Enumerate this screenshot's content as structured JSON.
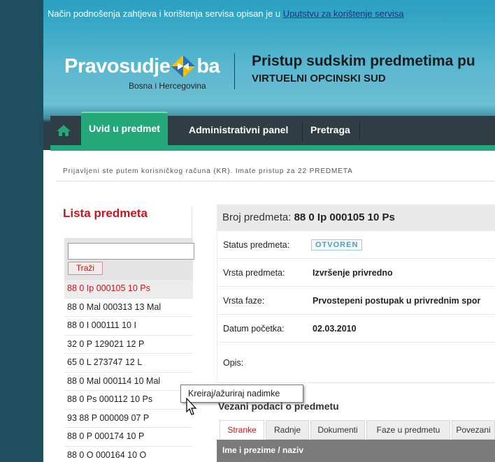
{
  "info_bar": {
    "text": "Način podnošenja zahtjeva i korištenja servisa opisan je u",
    "link": "Uputstvu za korištenje servisa"
  },
  "logo": {
    "name_left": "Pravosudje",
    "name_right": "ba",
    "subtitle": "Bosna i Hercegovina"
  },
  "page_header": {
    "title": "Pristup sudskim predmetima pu",
    "court": "VIRTUELNI OPCINSKI SUD"
  },
  "nav": {
    "home_icon": "home-icon",
    "tabs": [
      {
        "label": "Uvid u predmet",
        "active": true
      },
      {
        "label": "Administrativni panel",
        "active": false
      },
      {
        "label": "Pretraga",
        "active": false
      }
    ],
    "accent_color": "#24a879"
  },
  "login_info": "Prijavljeni ste putem korisničkog računa (KR). Imate pristup za 22 PREDMETA",
  "sidebar": {
    "title": "Lista predmeta",
    "search": {
      "value": "",
      "button": "Traži"
    },
    "cases": [
      {
        "label": "88 0 Ip 000105 10 Ps",
        "active": true
      },
      {
        "label": "88 0 Mal 000313 13 Mal",
        "active": false
      },
      {
        "label": "88 0 I 000111 10 I",
        "active": false
      },
      {
        "label": "32 0 P 129021 12 P",
        "active": false
      },
      {
        "label": "65 0 L 273747 12 L",
        "active": false
      },
      {
        "label": "88 0 Mal 000114 10 Mal",
        "active": false
      },
      {
        "label": "88 0 Ps 000112 10 Ps",
        "active": false
      },
      {
        "label": "93 88 P 000009 07 P",
        "active": false
      },
      {
        "label": "88 0 P 000174 10 P",
        "active": false
      },
      {
        "label": "88 0 O 000164 10 O",
        "active": false
      }
    ]
  },
  "case_detail": {
    "header_label": "Broj predmeta:",
    "header_value": "88 0 Ip 000105 10 Ps",
    "rows": [
      {
        "label": "Status predmeta:",
        "value": "OTVOREN",
        "badge": true
      },
      {
        "label": "Vrsta predmeta:",
        "value": "Izvršenje privredno"
      },
      {
        "label": "Vrsta faze:",
        "value": "Prvostepeni postupak u privrednim spor"
      },
      {
        "label": "Datum početka:",
        "value": "02.03.2010"
      },
      {
        "label": "Opis:",
        "value": ""
      }
    ]
  },
  "related": {
    "title": "Vezani podaci o predmetu",
    "tabs": [
      "Stranke",
      "Radnje",
      "Dokumenti",
      "Faze u predmetu",
      "Povezani"
    ],
    "active_tab": "Stranke",
    "table_header": "Ime i prezime / naziv"
  },
  "tooltip": "Kreiraj/ažuriraj nadimke"
}
